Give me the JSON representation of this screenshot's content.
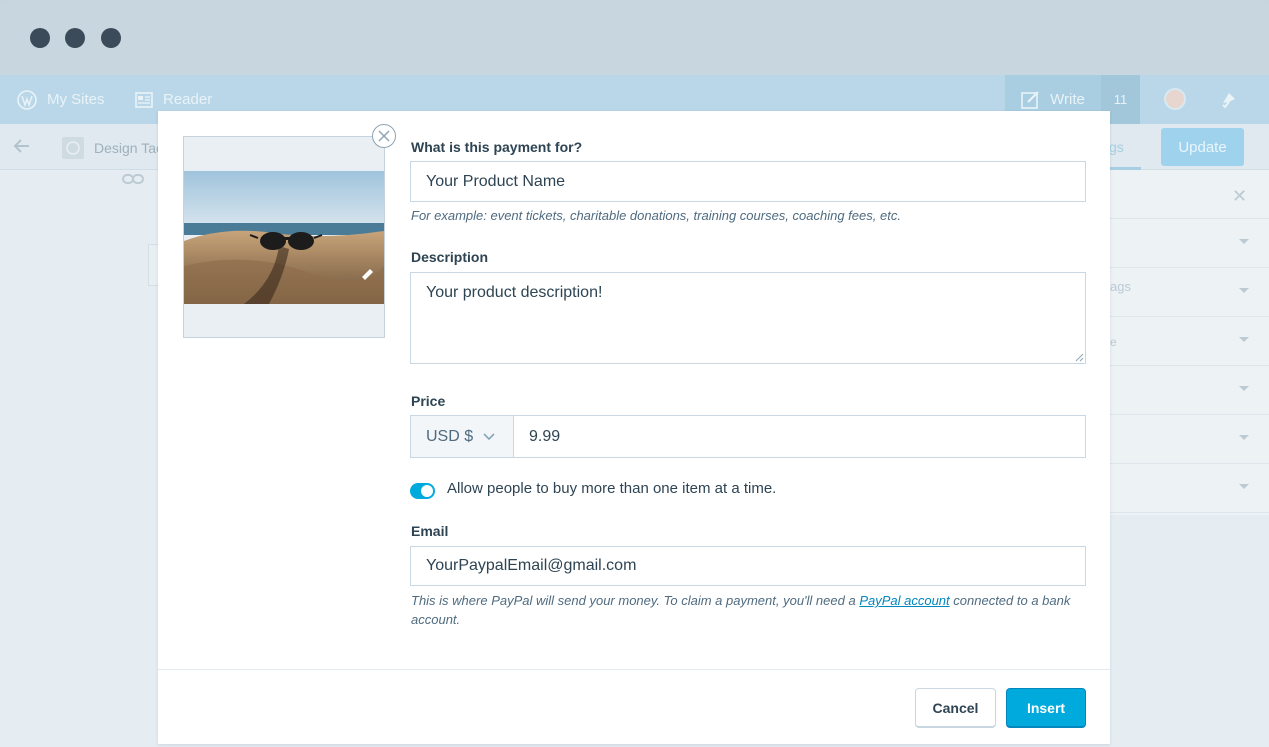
{
  "masterbar": {
    "my_sites": "My Sites",
    "reader": "Reader",
    "write": "Write",
    "count": "11"
  },
  "editor": {
    "site_name": "Design Tac",
    "update": "Update",
    "tab_fragment": "gs",
    "sidebar_fragment": "ags",
    "sidebar_fragment2": "e"
  },
  "dialog": {
    "payment_label": "What is this payment for?",
    "payment_value": "Your Product Name",
    "payment_help": "For example: event tickets, charitable donations, training courses, coaching fees, etc.",
    "description_label": "Description",
    "description_value": "Your product description!",
    "price_label": "Price",
    "currency": "USD $",
    "price_value": "9.99",
    "toggle_label": "Allow people to buy more than one item at a time.",
    "toggle_on": true,
    "email_label": "Email",
    "email_value": "YourPaypalEmail@gmail.com",
    "email_help_before": "This is where PayPal will send your money. To claim a payment, you'll need a ",
    "email_help_link": "PayPal account",
    "email_help_after": " connected to a bank account.",
    "cancel": "Cancel",
    "insert": "Insert"
  },
  "colors": {
    "accent": "#00aadc",
    "masterbar": "#b9d7e8",
    "text": "#2e4453"
  }
}
